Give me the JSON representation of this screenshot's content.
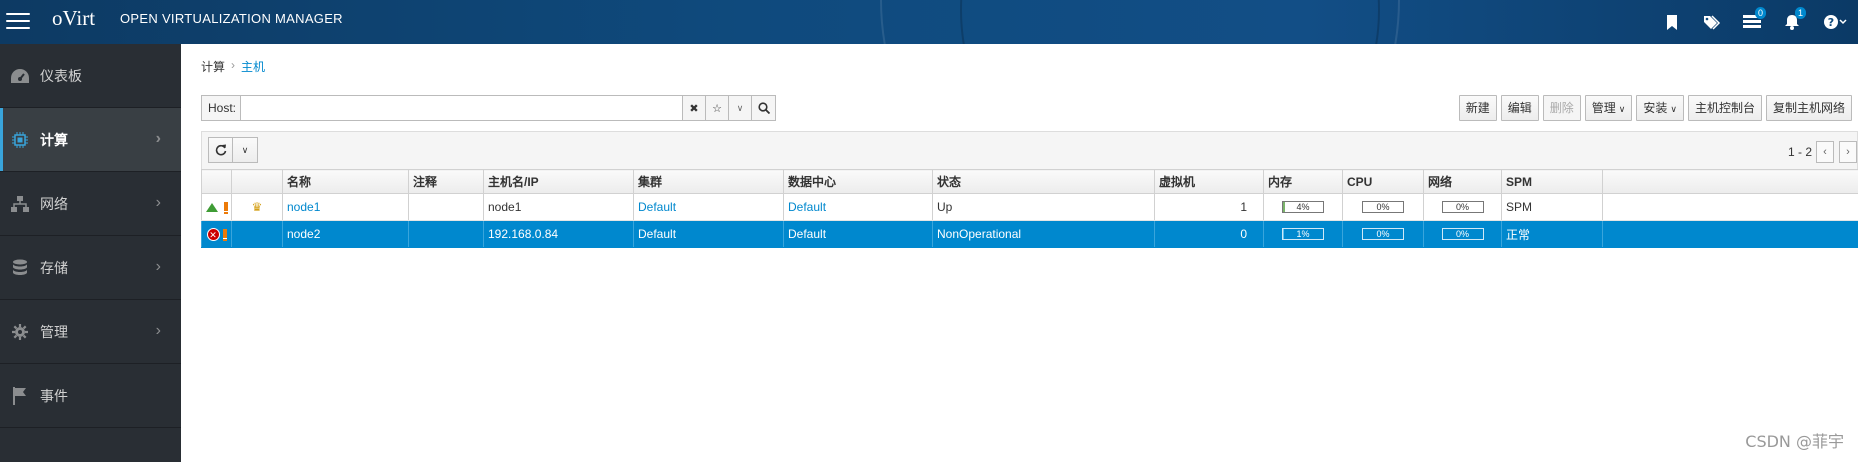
{
  "header": {
    "logo": "oVirt",
    "app_name": "OPEN VIRTUALIZATION MANAGER",
    "icons": [
      "bookmark-icon",
      "tags-icon",
      "tasks-icon",
      "bell-icon",
      "help-icon"
    ],
    "tasks_badge": "0",
    "notifications_badge": "1"
  },
  "sidebar": {
    "items": [
      {
        "label": "仪表板",
        "icon": "dashboard-icon",
        "active": false
      },
      {
        "label": "计算",
        "icon": "cpu-chip-icon",
        "active": true
      },
      {
        "label": "网络",
        "icon": "network-icon",
        "active": false
      },
      {
        "label": "存储",
        "icon": "database-icon",
        "active": false
      },
      {
        "label": "管理",
        "icon": "gear-icon",
        "active": false
      },
      {
        "label": "事件",
        "icon": "flag-icon",
        "active": false
      }
    ]
  },
  "breadcrumb": {
    "parent": "计算",
    "current": "主机"
  },
  "search": {
    "label": "Host:",
    "value": ""
  },
  "actions": {
    "new": "新建",
    "edit": "编辑",
    "remove": "删除",
    "manage": "管理",
    "install": "安装",
    "host_console": "主机控制台",
    "copy_host_networks": "复制主机网络"
  },
  "pager": {
    "range": "1 - 2"
  },
  "table": {
    "columns": [
      "名称",
      "注释",
      "主机名/IP",
      "集群",
      "数据中心",
      "状态",
      "虚拟机",
      "内存",
      "CPU",
      "网络",
      "SPM"
    ],
    "rows": [
      {
        "status_icon": "up-arrow-icon",
        "name": "node1",
        "comment": "",
        "host": "node1",
        "cluster": "Default",
        "datacenter": "Default",
        "state": "Up",
        "vms": "1",
        "memory": "4%",
        "memory_value": 4,
        "cpu": "0%",
        "cpu_value": 0,
        "network": "0%",
        "network_value": 0,
        "spm": "SPM",
        "selected": false
      },
      {
        "status_icon": "error-icon",
        "name": "node2",
        "comment": "",
        "host": "192.168.0.84",
        "cluster": "Default",
        "datacenter": "Default",
        "state": "NonOperational",
        "vms": "0",
        "memory": "1%",
        "memory_value": 1,
        "cpu": "0%",
        "cpu_value": 0,
        "network": "0%",
        "network_value": 0,
        "spm": "正常",
        "selected": true
      }
    ]
  },
  "watermark": "CSDN @菲宇"
}
